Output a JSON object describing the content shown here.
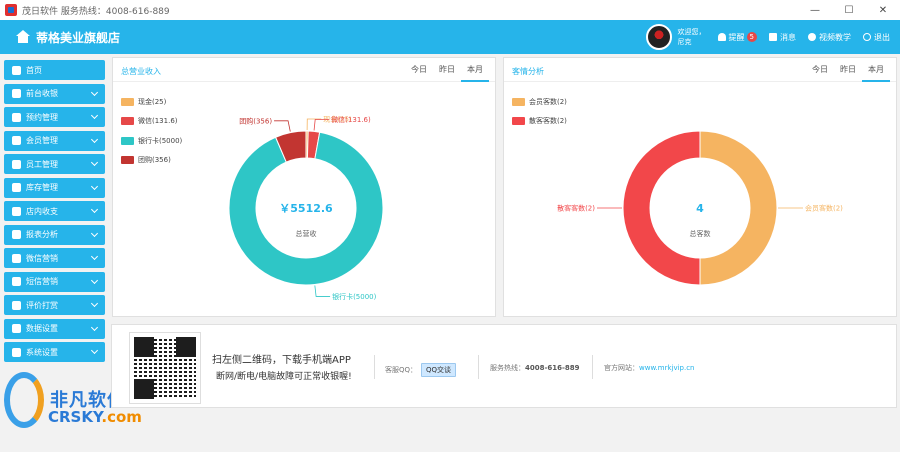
{
  "window": {
    "title": "茂日软件 服务热线：4008-616-889",
    "controls": [
      "—",
      "☐",
      "✕"
    ]
  },
  "header": {
    "store_name": "蒂格美业旗舰店",
    "greeting_line1": "欢迎您，",
    "greeting_line2": "尼克",
    "reminder_label": "提醒",
    "reminder_count": "5",
    "message_label": "消息",
    "video_label": "视频教学",
    "logout_label": "退出"
  },
  "sidebar": {
    "items": [
      {
        "label": "首页",
        "has_chevron": false
      },
      {
        "label": "前台收银",
        "has_chevron": true
      },
      {
        "label": "预约管理",
        "has_chevron": true
      },
      {
        "label": "会员管理",
        "has_chevron": true
      },
      {
        "label": "员工管理",
        "has_chevron": true
      },
      {
        "label": "库存管理",
        "has_chevron": true
      },
      {
        "label": "店内收支",
        "has_chevron": true
      },
      {
        "label": "报表分析",
        "has_chevron": true
      },
      {
        "label": "微信营销",
        "has_chevron": true
      },
      {
        "label": "短信营销",
        "has_chevron": true
      },
      {
        "label": "评价打赏",
        "has_chevron": true
      },
      {
        "label": "数据设置",
        "has_chevron": true
      },
      {
        "label": "系统设置",
        "has_chevron": true
      }
    ]
  },
  "watermark": {
    "cn": "非凡软件站",
    "en_prefix": "CRSKY",
    "en_suffix": ".com"
  },
  "revenue_card": {
    "title": "总营业收入",
    "tabs": [
      "今日",
      "昨日",
      "本月"
    ],
    "active_tab": "本月",
    "center_value": "￥5512.6",
    "center_label": "总营收",
    "slices": [
      {
        "name": "现金",
        "value": 25,
        "label": "现金(25)",
        "color": "#f5b461"
      },
      {
        "name": "微信",
        "value": 131.6,
        "label": "微信(131.6)",
        "color": "#e64848"
      },
      {
        "name": "银行卡",
        "value": 5000,
        "label": "银行卡(5000)",
        "color": "#2ec6c6"
      },
      {
        "name": "团购",
        "value": 356,
        "label": "团购(356)",
        "color": "#c23531"
      }
    ]
  },
  "customer_card": {
    "title": "客情分析",
    "tabs": [
      "今日",
      "昨日",
      "本月"
    ],
    "active_tab": "本月",
    "center_value": "4",
    "center_label": "总客数",
    "slices": [
      {
        "name": "会员客数",
        "value": 2,
        "label": "会员客数(2)",
        "color": "#f5b461"
      },
      {
        "name": "散客客数",
        "value": 2,
        "label": "散客客数(2)",
        "color": "#f2474a"
      }
    ]
  },
  "banner": {
    "main_text": "扫左侧二维码，下载手机端APP",
    "sub_text": "断网/断电/电脑故障可正常收银喔!",
    "qq_label": "客服QQ：",
    "qq_button": "QQ交谈",
    "hotline_label": "服务热线：",
    "hotline_value": "4008-616-889",
    "website_label": "官方网站：",
    "website_value": "www.mrkjvip.cn"
  }
}
